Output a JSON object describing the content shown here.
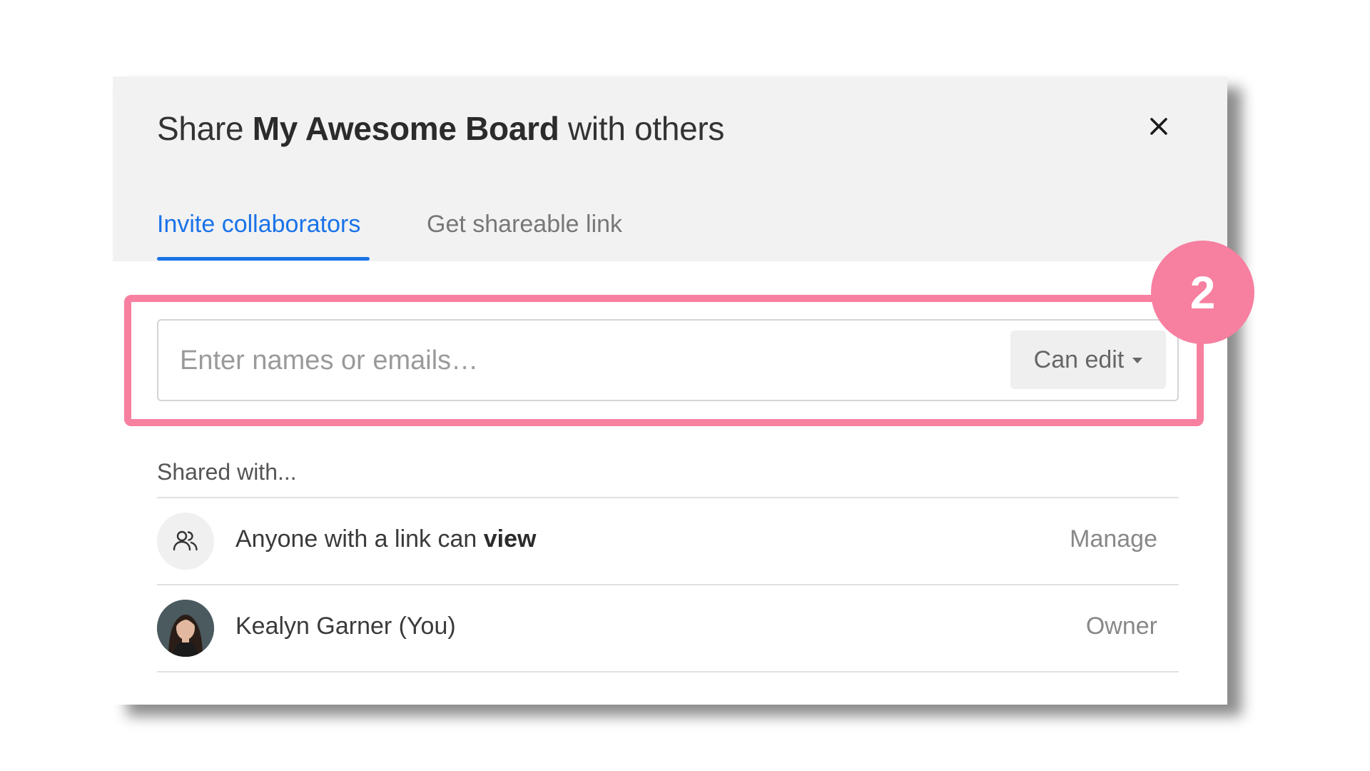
{
  "dialog": {
    "title_prefix": "Share ",
    "title_board": "My Awesome Board",
    "title_suffix": " with others",
    "close_icon": "close-icon"
  },
  "tabs": [
    {
      "label": "Invite collaborators",
      "active": true
    },
    {
      "label": "Get shareable link",
      "active": false
    }
  ],
  "invite": {
    "placeholder": "Enter names or emails…",
    "value": "",
    "permission": "Can edit"
  },
  "annotation": {
    "step": "2",
    "color": "#f77fa0"
  },
  "shared": {
    "label": "Shared with...",
    "rows": [
      {
        "icon": "people-icon",
        "text": "Anyone with a link can ",
        "emphasis": "view",
        "action": "Manage"
      },
      {
        "icon": "user-avatar",
        "text": "Kealyn Garner (You)",
        "action": "Owner"
      }
    ]
  },
  "colors": {
    "accent": "#1a73e8",
    "header_bg": "#f2f2f2"
  }
}
